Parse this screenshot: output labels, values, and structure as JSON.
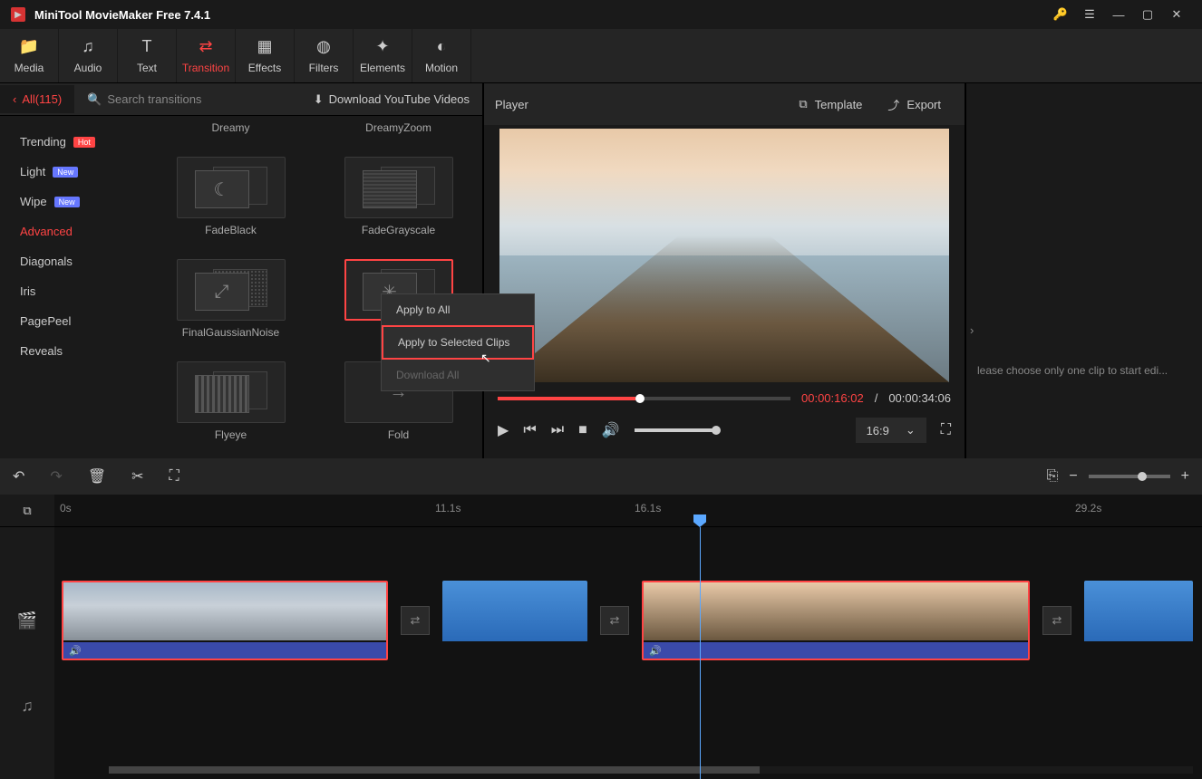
{
  "app": {
    "title": "MiniTool MovieMaker Free 7.4.1"
  },
  "toolbar": {
    "media": "Media",
    "audio": "Audio",
    "text": "Text",
    "transition": "Transition",
    "effects": "Effects",
    "filters": "Filters",
    "elements": "Elements",
    "motion": "Motion"
  },
  "leftHeader": {
    "all": "All(115)",
    "search": "Search transitions",
    "dlYt": "Download YouTube Videos"
  },
  "categories": {
    "trending": "Trending",
    "light": "Light",
    "wipe": "Wipe",
    "advanced": "Advanced",
    "diagonals": "Diagonals",
    "iris": "Iris",
    "pagepeel": "PagePeel",
    "reveals": "Reveals",
    "hot": "Hot",
    "new": "New"
  },
  "transitions": {
    "dreamy": "Dreamy",
    "dreamyzoom": "DreamyZoom",
    "fadeblack": "FadeBlack",
    "fadegrayscale": "FadeGrayscale",
    "finalgaussian": "FinalGaussianNoise",
    "flash": "Fla",
    "flyeye": "Flyeye",
    "fold": "Fold"
  },
  "contextMenu": {
    "applyAll": "Apply to All",
    "applySelected": "Apply to Selected Clips",
    "downloadAll": "Download All"
  },
  "player": {
    "title": "Player",
    "template": "Template",
    "export": "Export",
    "cur": "00:00:16:02",
    "sep": "/",
    "dur": "00:00:34:06",
    "ratio": "16:9"
  },
  "rightPanel": {
    "hint": "lease choose only one clip to start edi..."
  },
  "ruler": {
    "t0": "0s",
    "t1": "11.1s",
    "t2": "16.1s",
    "t3": "29.2s"
  }
}
